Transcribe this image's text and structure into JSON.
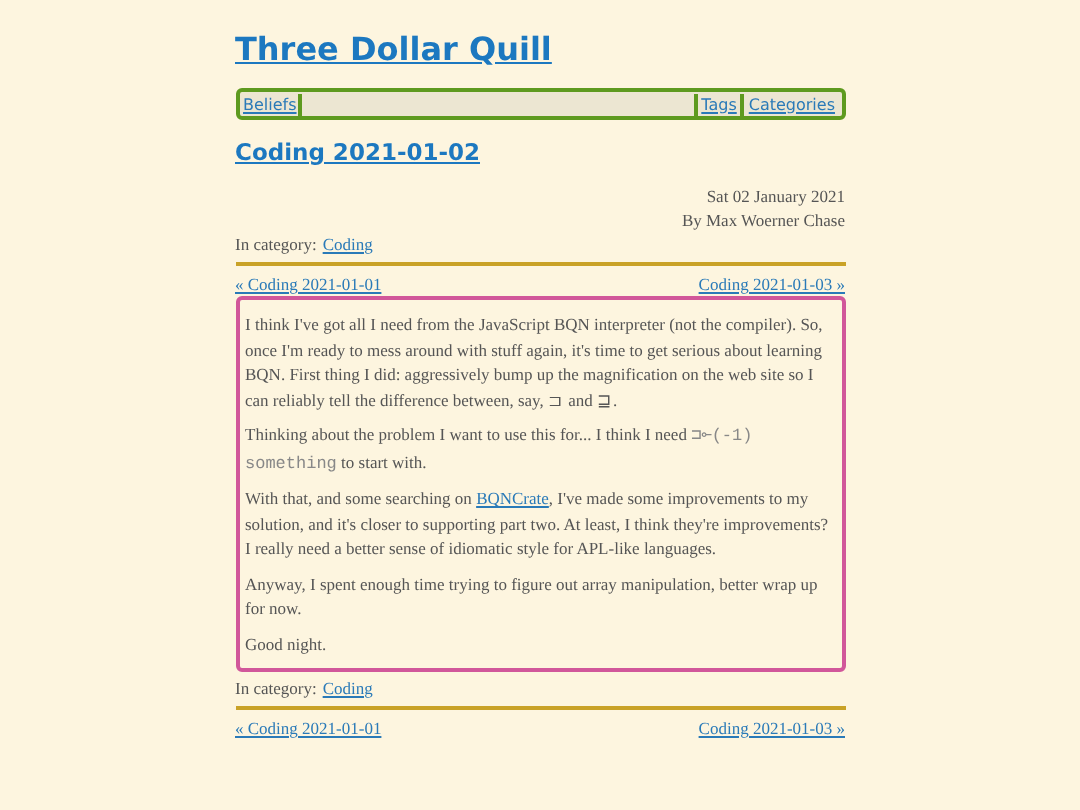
{
  "site_title": "Three Dollar Quill",
  "nav": {
    "left": [
      {
        "label": "Beliefs"
      }
    ],
    "right": [
      {
        "label": "Tags"
      },
      {
        "label": "Categories"
      }
    ]
  },
  "post": {
    "title": "Coding 2021-01-02",
    "date": "Sat 02 January 2021",
    "author": "By Max Woerner Chase",
    "category_label": "In category:",
    "category": "Coding",
    "prev": "« Coding 2021-01-01",
    "next": "Coding 2021-01-03 »",
    "paragraphs": [
      [
        {
          "kind": "text",
          "text": "I think I've got all I need from the JavaScript BQN interpreter (not the compiler). So, once I'm ready to mess around with stuff again, it's time to get serious about learning BQN. First thing I did: aggressively bump up the magnification on the web site so I can reliably tell the difference between, say, ⊐ and ⊒."
        }
      ],
      [
        {
          "kind": "text",
          "text": "Thinking about the problem I want to use this for... I think I need "
        },
        {
          "kind": "code",
          "text": "⊐⟜(-1) something"
        },
        {
          "kind": "text",
          "text": " to start with."
        }
      ],
      [
        {
          "kind": "text",
          "text": "With that, and some searching on "
        },
        {
          "kind": "link",
          "text": "BQNCrate"
        },
        {
          "kind": "text",
          "text": ", I've made some improvements to my solution, and it's closer to supporting part two. At least, I think they're improvements? I really need a better sense of idiomatic style for APL-like languages."
        }
      ],
      [
        {
          "kind": "text",
          "text": "Anyway, I spent enough time trying to figure out array manipulation, better wrap up for now."
        }
      ],
      [
        {
          "kind": "text",
          "text": "Good night."
        }
      ]
    ],
    "footer_category_label": "In category:",
    "footer_category": "Coding",
    "footer_prev": "« Coding 2021-01-01",
    "footer_next": "Coding 2021-01-03 »"
  }
}
